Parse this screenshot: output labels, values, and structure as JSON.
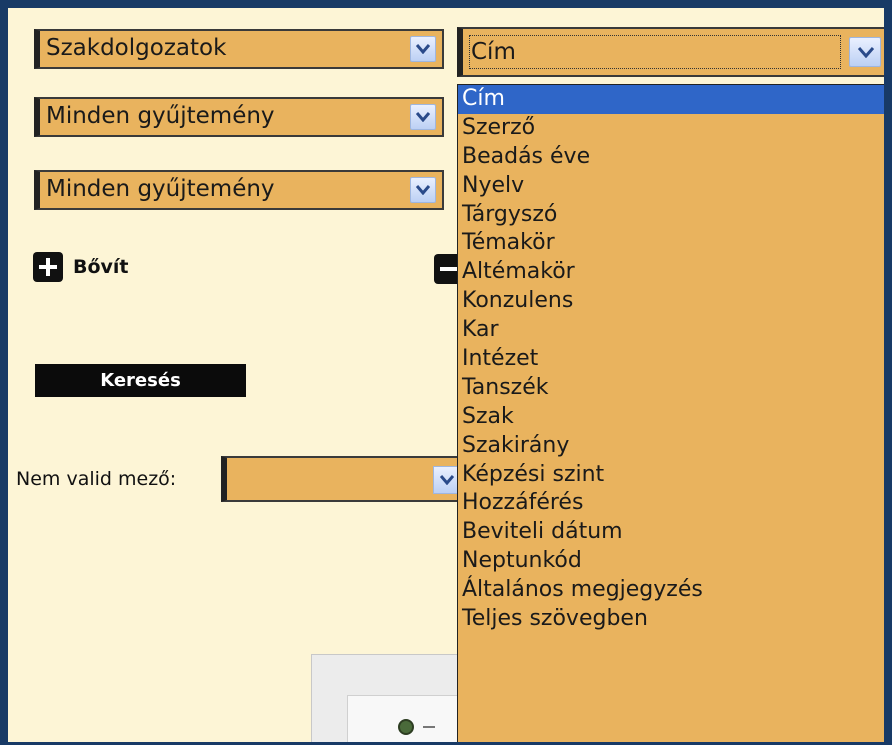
{
  "selects": {
    "doc_type": "Szakdolgozatok",
    "collection1": "Minden gyűjtemény",
    "collection2": "Minden gyűjtemény"
  },
  "field_select": {
    "selected": "Cím",
    "options": [
      "Cím",
      "Szerző",
      "Beadás éve",
      "Nyelv",
      "Tárgyszó",
      "Témakör",
      "Altémakör",
      "Konzulens",
      "Kar",
      "Intézet",
      "Tanszék",
      "Szak",
      "Szakirány",
      "Képzési szint",
      "Hozzáférés",
      "Beviteli dátum",
      "Neptunkód",
      "Általános megjegyzés",
      "Teljes szövegben"
    ]
  },
  "actions": {
    "expand_label": "Bővít",
    "search_label": "Keresés"
  },
  "invalid_field": {
    "label": "Nem valid mező:",
    "value": ""
  },
  "colors": {
    "field_bg": "#e9b35e",
    "page_bg": "#fdf5d6",
    "highlight": "#2f66c8",
    "frame": "#183a66"
  }
}
